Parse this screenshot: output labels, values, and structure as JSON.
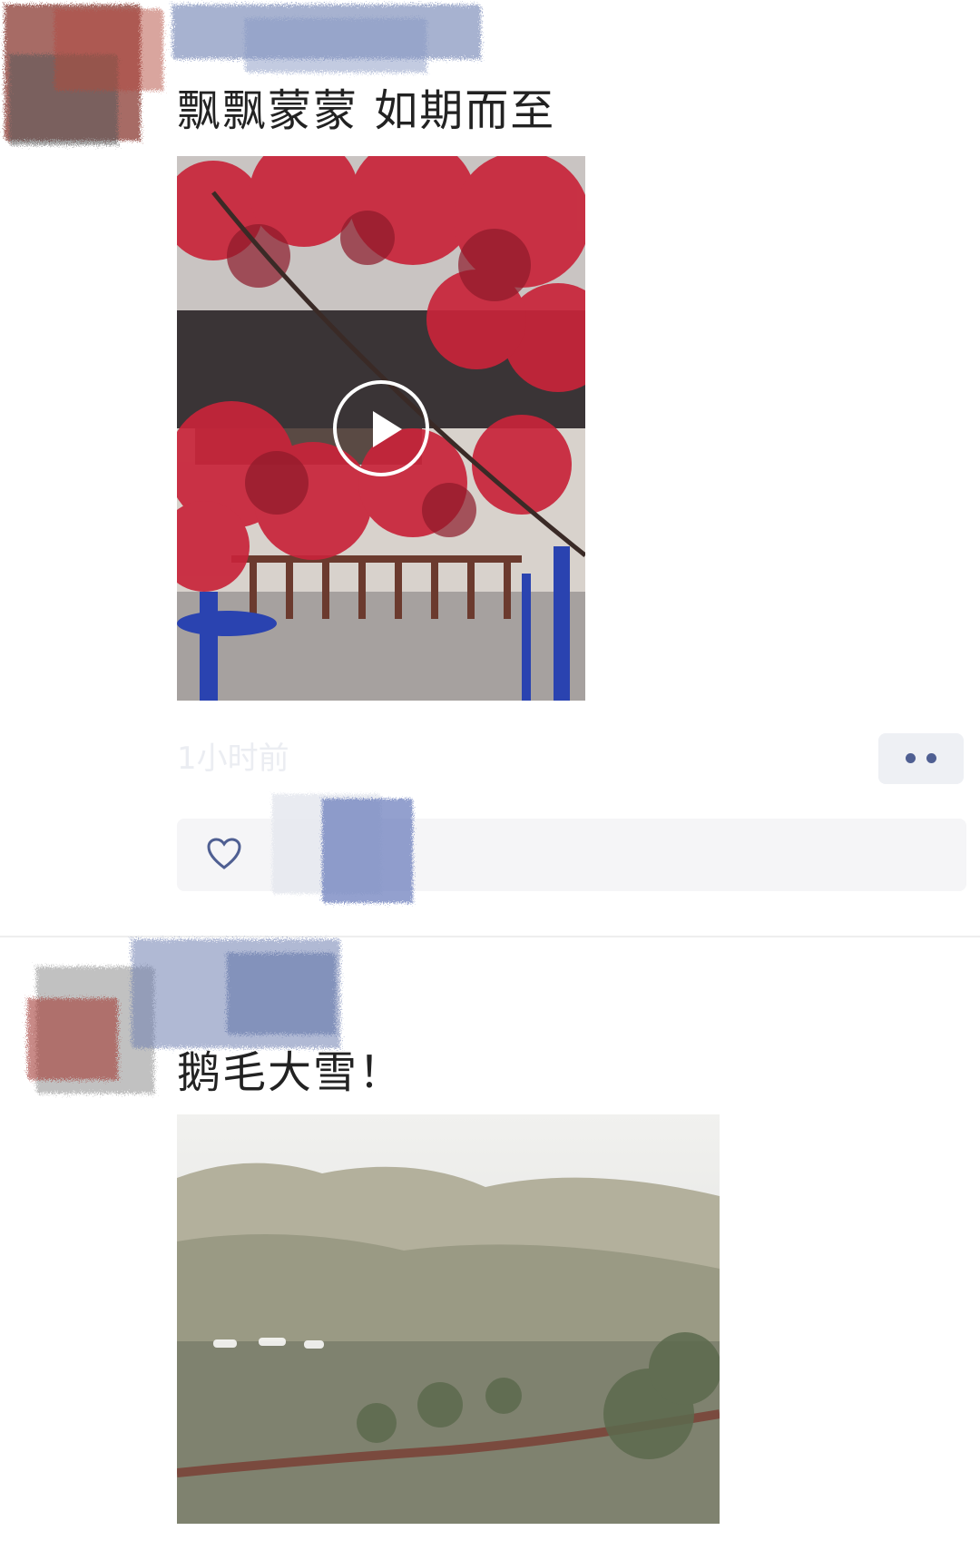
{
  "posts": [
    {
      "text": "飘飘蒙蒙  如期而至",
      "media_type": "video",
      "media_description_icon": "play-icon",
      "time": "1小时前",
      "more_icon": "more-dots-icon",
      "like_icon": "heart-icon"
    },
    {
      "text": "鹅毛大雪！",
      "media_type": "image"
    }
  ],
  "colors": {
    "link_blue": "#4f5f92",
    "bar_bg": "#f5f5f7",
    "timestamp": "#ebedf2"
  }
}
